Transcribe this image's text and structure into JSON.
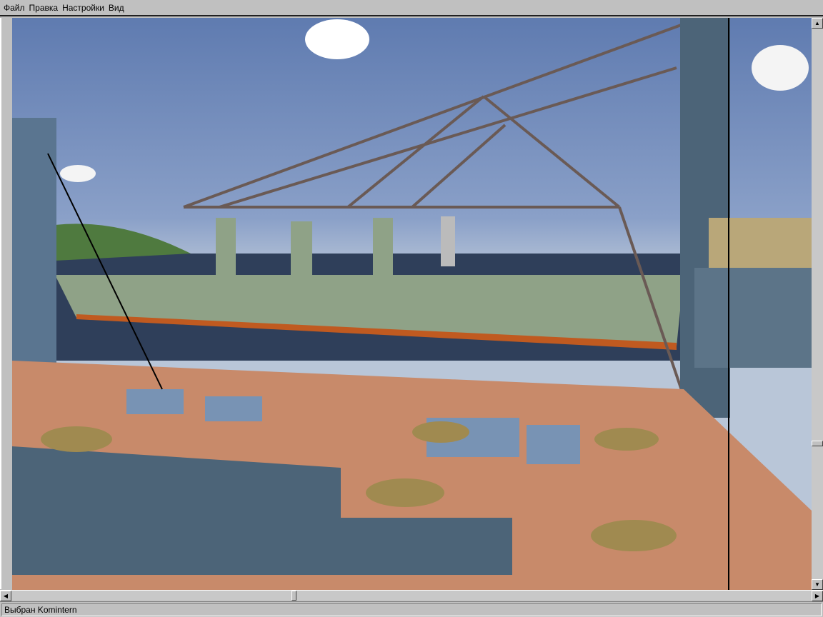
{
  "menu": {
    "items": [
      {
        "label": "Файл"
      },
      {
        "label": "Правка"
      },
      {
        "label": "Настройки"
      },
      {
        "label": "Вид"
      }
    ]
  },
  "status": {
    "text": "Выбран Komintern"
  },
  "scrollbars": {
    "horizontal_position": 0.36,
    "vertical_position": 0.76
  },
  "colors": {
    "sky": "#6f88b8",
    "sea": "#2f3f5a",
    "deck": "#c88a6a",
    "hull": "#5a7590",
    "ship": "#8fa287"
  }
}
